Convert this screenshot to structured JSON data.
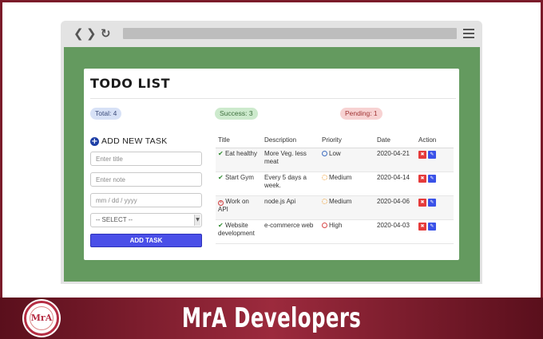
{
  "app": {
    "title": "TODO LIST"
  },
  "stats": {
    "total": "Total: 4",
    "success": "Success: 3",
    "pending": "Pending: 1"
  },
  "form": {
    "heading": "ADD NEW TASK",
    "title_placeholder": "Enter title",
    "note_placeholder": "Enter note",
    "date_placeholder": "mm / dd / yyyy",
    "select_value": "-- SELECT --",
    "submit_label": "ADD TASK"
  },
  "table": {
    "headers": [
      "Title",
      "Description",
      "Priority",
      "Date",
      "Action"
    ],
    "rows": [
      {
        "status": "done",
        "title": "Eat healthy",
        "description": "More Veg. less meat",
        "priority": "Low",
        "date": "2020-04-21"
      },
      {
        "status": "done",
        "title": "Start Gym",
        "description": "Every 5 days a week.",
        "priority": "Medium",
        "date": "2020-04-14"
      },
      {
        "status": "pending",
        "title": "Work on API",
        "description": "node.js Api",
        "priority": "Medium",
        "date": "2020-04-06"
      },
      {
        "status": "done",
        "title": "Website development",
        "description": "e-commerce web",
        "priority": "High",
        "date": "2020-04-03"
      }
    ]
  },
  "icons": {
    "done": "check-icon",
    "pending": "x-circle-icon",
    "delete": "trash-icon",
    "edit": "edit-icon"
  },
  "colors": {
    "viewport_bg": "#649a5f",
    "add_button": "#4a4fe8",
    "footer_bg": "#9c2a3d"
  },
  "footer": {
    "brand": "MrA Developers",
    "logo_text": "MrA"
  }
}
